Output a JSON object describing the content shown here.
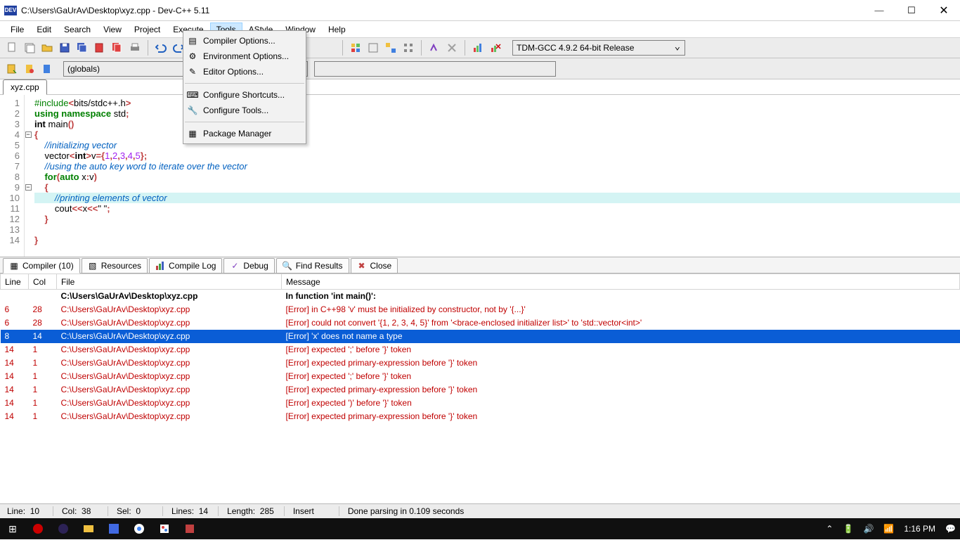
{
  "window": {
    "app_badge": "DEV",
    "title": "C:\\Users\\GaUrAv\\Desktop\\xyz.cpp - Dev-C++ 5.11"
  },
  "menubar": [
    "File",
    "Edit",
    "Search",
    "View",
    "Project",
    "Execute",
    "Tools",
    "AStyle",
    "Window",
    "Help"
  ],
  "tools_menu": {
    "items": [
      "Compiler Options...",
      "Environment Options...",
      "Editor Options...",
      "Configure Shortcuts...",
      "Configure Tools...",
      "Package Manager"
    ]
  },
  "compiler_combo": "TDM-GCC 4.9.2 64-bit Release",
  "globals_combo": "(globals)",
  "editor_tab": "xyz.cpp",
  "code_lines": 14,
  "bottom_tabs": {
    "compiler": "Compiler (10)",
    "resources": "Resources",
    "compile_log": "Compile Log",
    "debug": "Debug",
    "find_results": "Find Results",
    "close": "Close"
  },
  "error_headers": {
    "line": "Line",
    "col": "Col",
    "file": "File",
    "message": "Message"
  },
  "error_rows": [
    {
      "line": "",
      "col": "",
      "file": "C:\\Users\\GaUrAv\\Desktop\\xyz.cpp",
      "msg": "In function 'int main()':",
      "kind": "hdr"
    },
    {
      "line": "6",
      "col": "28",
      "file": "C:\\Users\\GaUrAv\\Desktop\\xyz.cpp",
      "msg": "[Error] in C++98 'v' must be initialized by constructor, not by '{...}'",
      "kind": "err"
    },
    {
      "line": "6",
      "col": "28",
      "file": "C:\\Users\\GaUrAv\\Desktop\\xyz.cpp",
      "msg": "[Error] could not convert '{1, 2, 3, 4, 5}' from '<brace-enclosed initializer list>' to 'std::vector<int>'",
      "kind": "err"
    },
    {
      "line": "8",
      "col": "14",
      "file": "C:\\Users\\GaUrAv\\Desktop\\xyz.cpp",
      "msg": "[Error] 'x' does not name a type",
      "kind": "sel"
    },
    {
      "line": "14",
      "col": "1",
      "file": "C:\\Users\\GaUrAv\\Desktop\\xyz.cpp",
      "msg": "[Error] expected ';' before '}' token",
      "kind": "err"
    },
    {
      "line": "14",
      "col": "1",
      "file": "C:\\Users\\GaUrAv\\Desktop\\xyz.cpp",
      "msg": "[Error] expected primary-expression before '}' token",
      "kind": "err"
    },
    {
      "line": "14",
      "col": "1",
      "file": "C:\\Users\\GaUrAv\\Desktop\\xyz.cpp",
      "msg": "[Error] expected ';' before '}' token",
      "kind": "err"
    },
    {
      "line": "14",
      "col": "1",
      "file": "C:\\Users\\GaUrAv\\Desktop\\xyz.cpp",
      "msg": "[Error] expected primary-expression before '}' token",
      "kind": "err"
    },
    {
      "line": "14",
      "col": "1",
      "file": "C:\\Users\\GaUrAv\\Desktop\\xyz.cpp",
      "msg": "[Error] expected ')' before '}' token",
      "kind": "err"
    },
    {
      "line": "14",
      "col": "1",
      "file": "C:\\Users\\GaUrAv\\Desktop\\xyz.cpp",
      "msg": "[Error] expected primary-expression before '}' token",
      "kind": "err"
    }
  ],
  "status": {
    "line_lbl": "Line:",
    "line_val": "10",
    "col_lbl": "Col:",
    "col_val": "38",
    "sel_lbl": "Sel:",
    "sel_val": "0",
    "lines_lbl": "Lines:",
    "lines_val": "14",
    "length_lbl": "Length:",
    "length_val": "285",
    "mode": "Insert",
    "parse": "Done parsing in 0.109 seconds"
  },
  "taskbar": {
    "time": "1:16 PM"
  }
}
